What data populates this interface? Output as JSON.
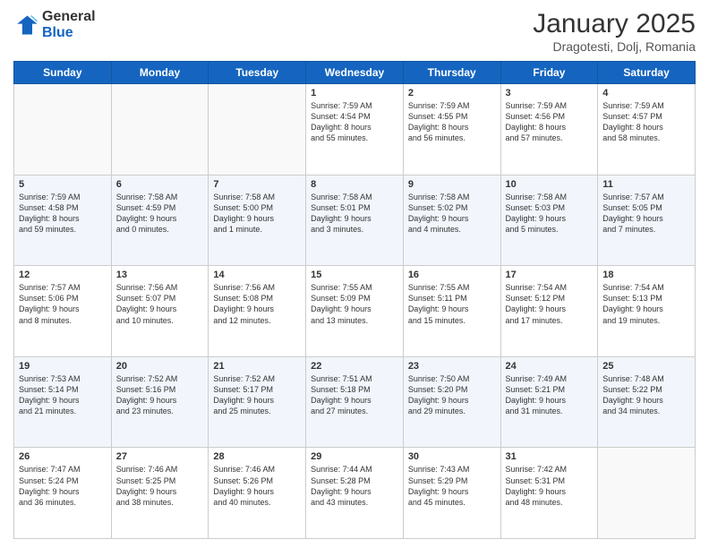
{
  "header": {
    "logo_general": "General",
    "logo_blue": "Blue",
    "month_title": "January 2025",
    "location": "Dragotesti, Dolj, Romania"
  },
  "weekdays": [
    "Sunday",
    "Monday",
    "Tuesday",
    "Wednesday",
    "Thursday",
    "Friday",
    "Saturday"
  ],
  "weeks": [
    [
      {
        "day": "",
        "info": ""
      },
      {
        "day": "",
        "info": ""
      },
      {
        "day": "",
        "info": ""
      },
      {
        "day": "1",
        "info": "Sunrise: 7:59 AM\nSunset: 4:54 PM\nDaylight: 8 hours\nand 55 minutes."
      },
      {
        "day": "2",
        "info": "Sunrise: 7:59 AM\nSunset: 4:55 PM\nDaylight: 8 hours\nand 56 minutes."
      },
      {
        "day": "3",
        "info": "Sunrise: 7:59 AM\nSunset: 4:56 PM\nDaylight: 8 hours\nand 57 minutes."
      },
      {
        "day": "4",
        "info": "Sunrise: 7:59 AM\nSunset: 4:57 PM\nDaylight: 8 hours\nand 58 minutes."
      }
    ],
    [
      {
        "day": "5",
        "info": "Sunrise: 7:59 AM\nSunset: 4:58 PM\nDaylight: 8 hours\nand 59 minutes."
      },
      {
        "day": "6",
        "info": "Sunrise: 7:58 AM\nSunset: 4:59 PM\nDaylight: 9 hours\nand 0 minutes."
      },
      {
        "day": "7",
        "info": "Sunrise: 7:58 AM\nSunset: 5:00 PM\nDaylight: 9 hours\nand 1 minute."
      },
      {
        "day": "8",
        "info": "Sunrise: 7:58 AM\nSunset: 5:01 PM\nDaylight: 9 hours\nand 3 minutes."
      },
      {
        "day": "9",
        "info": "Sunrise: 7:58 AM\nSunset: 5:02 PM\nDaylight: 9 hours\nand 4 minutes."
      },
      {
        "day": "10",
        "info": "Sunrise: 7:58 AM\nSunset: 5:03 PM\nDaylight: 9 hours\nand 5 minutes."
      },
      {
        "day": "11",
        "info": "Sunrise: 7:57 AM\nSunset: 5:05 PM\nDaylight: 9 hours\nand 7 minutes."
      }
    ],
    [
      {
        "day": "12",
        "info": "Sunrise: 7:57 AM\nSunset: 5:06 PM\nDaylight: 9 hours\nand 8 minutes."
      },
      {
        "day": "13",
        "info": "Sunrise: 7:56 AM\nSunset: 5:07 PM\nDaylight: 9 hours\nand 10 minutes."
      },
      {
        "day": "14",
        "info": "Sunrise: 7:56 AM\nSunset: 5:08 PM\nDaylight: 9 hours\nand 12 minutes."
      },
      {
        "day": "15",
        "info": "Sunrise: 7:55 AM\nSunset: 5:09 PM\nDaylight: 9 hours\nand 13 minutes."
      },
      {
        "day": "16",
        "info": "Sunrise: 7:55 AM\nSunset: 5:11 PM\nDaylight: 9 hours\nand 15 minutes."
      },
      {
        "day": "17",
        "info": "Sunrise: 7:54 AM\nSunset: 5:12 PM\nDaylight: 9 hours\nand 17 minutes."
      },
      {
        "day": "18",
        "info": "Sunrise: 7:54 AM\nSunset: 5:13 PM\nDaylight: 9 hours\nand 19 minutes."
      }
    ],
    [
      {
        "day": "19",
        "info": "Sunrise: 7:53 AM\nSunset: 5:14 PM\nDaylight: 9 hours\nand 21 minutes."
      },
      {
        "day": "20",
        "info": "Sunrise: 7:52 AM\nSunset: 5:16 PM\nDaylight: 9 hours\nand 23 minutes."
      },
      {
        "day": "21",
        "info": "Sunrise: 7:52 AM\nSunset: 5:17 PM\nDaylight: 9 hours\nand 25 minutes."
      },
      {
        "day": "22",
        "info": "Sunrise: 7:51 AM\nSunset: 5:18 PM\nDaylight: 9 hours\nand 27 minutes."
      },
      {
        "day": "23",
        "info": "Sunrise: 7:50 AM\nSunset: 5:20 PM\nDaylight: 9 hours\nand 29 minutes."
      },
      {
        "day": "24",
        "info": "Sunrise: 7:49 AM\nSunset: 5:21 PM\nDaylight: 9 hours\nand 31 minutes."
      },
      {
        "day": "25",
        "info": "Sunrise: 7:48 AM\nSunset: 5:22 PM\nDaylight: 9 hours\nand 34 minutes."
      }
    ],
    [
      {
        "day": "26",
        "info": "Sunrise: 7:47 AM\nSunset: 5:24 PM\nDaylight: 9 hours\nand 36 minutes."
      },
      {
        "day": "27",
        "info": "Sunrise: 7:46 AM\nSunset: 5:25 PM\nDaylight: 9 hours\nand 38 minutes."
      },
      {
        "day": "28",
        "info": "Sunrise: 7:46 AM\nSunset: 5:26 PM\nDaylight: 9 hours\nand 40 minutes."
      },
      {
        "day": "29",
        "info": "Sunrise: 7:44 AM\nSunset: 5:28 PM\nDaylight: 9 hours\nand 43 minutes."
      },
      {
        "day": "30",
        "info": "Sunrise: 7:43 AM\nSunset: 5:29 PM\nDaylight: 9 hours\nand 45 minutes."
      },
      {
        "day": "31",
        "info": "Sunrise: 7:42 AM\nSunset: 5:31 PM\nDaylight: 9 hours\nand 48 minutes."
      },
      {
        "day": "",
        "info": ""
      }
    ]
  ]
}
